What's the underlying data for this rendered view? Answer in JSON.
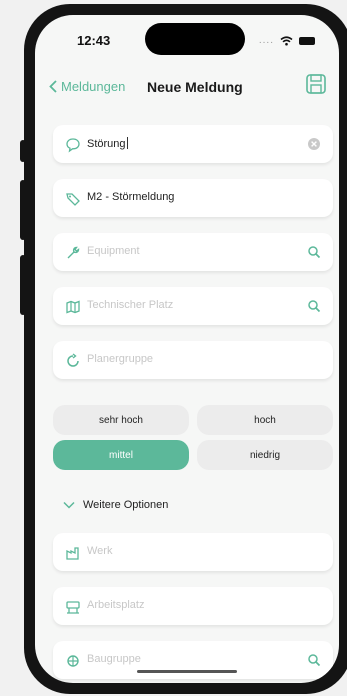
{
  "status_bar": {
    "time": "12:43",
    "signal_dots": "...."
  },
  "nav": {
    "back_label": "Meldungen",
    "title": "Neue Meldung"
  },
  "form": {
    "stoerung": {
      "value": "Störung",
      "icon": "speech-bubble-icon"
    },
    "meldungsart": {
      "value": "M2 - Störmeldung",
      "icon": "tag-icon"
    },
    "equipment": {
      "placeholder": "Equipment",
      "icon": "wrench-icon"
    },
    "technischer_platz": {
      "placeholder": "Technischer Platz",
      "icon": "map-icon"
    },
    "planergruppe": {
      "placeholder": "Planergruppe",
      "icon": "cycle-icon"
    }
  },
  "priority": {
    "options": [
      "sehr hoch",
      "hoch",
      "mittel",
      "niedrig"
    ],
    "selected": "mittel",
    "accent_color": "#5cb89a"
  },
  "more_options": {
    "label": "Weitere Optionen"
  },
  "extra": {
    "werk": {
      "placeholder": "Werk",
      "icon": "factory-icon"
    },
    "arbeitsplatz": {
      "placeholder": "Arbeitsplatz",
      "icon": "workstation-icon"
    },
    "baugruppe": {
      "placeholder": "Baugruppe",
      "icon": "component-icon"
    }
  }
}
